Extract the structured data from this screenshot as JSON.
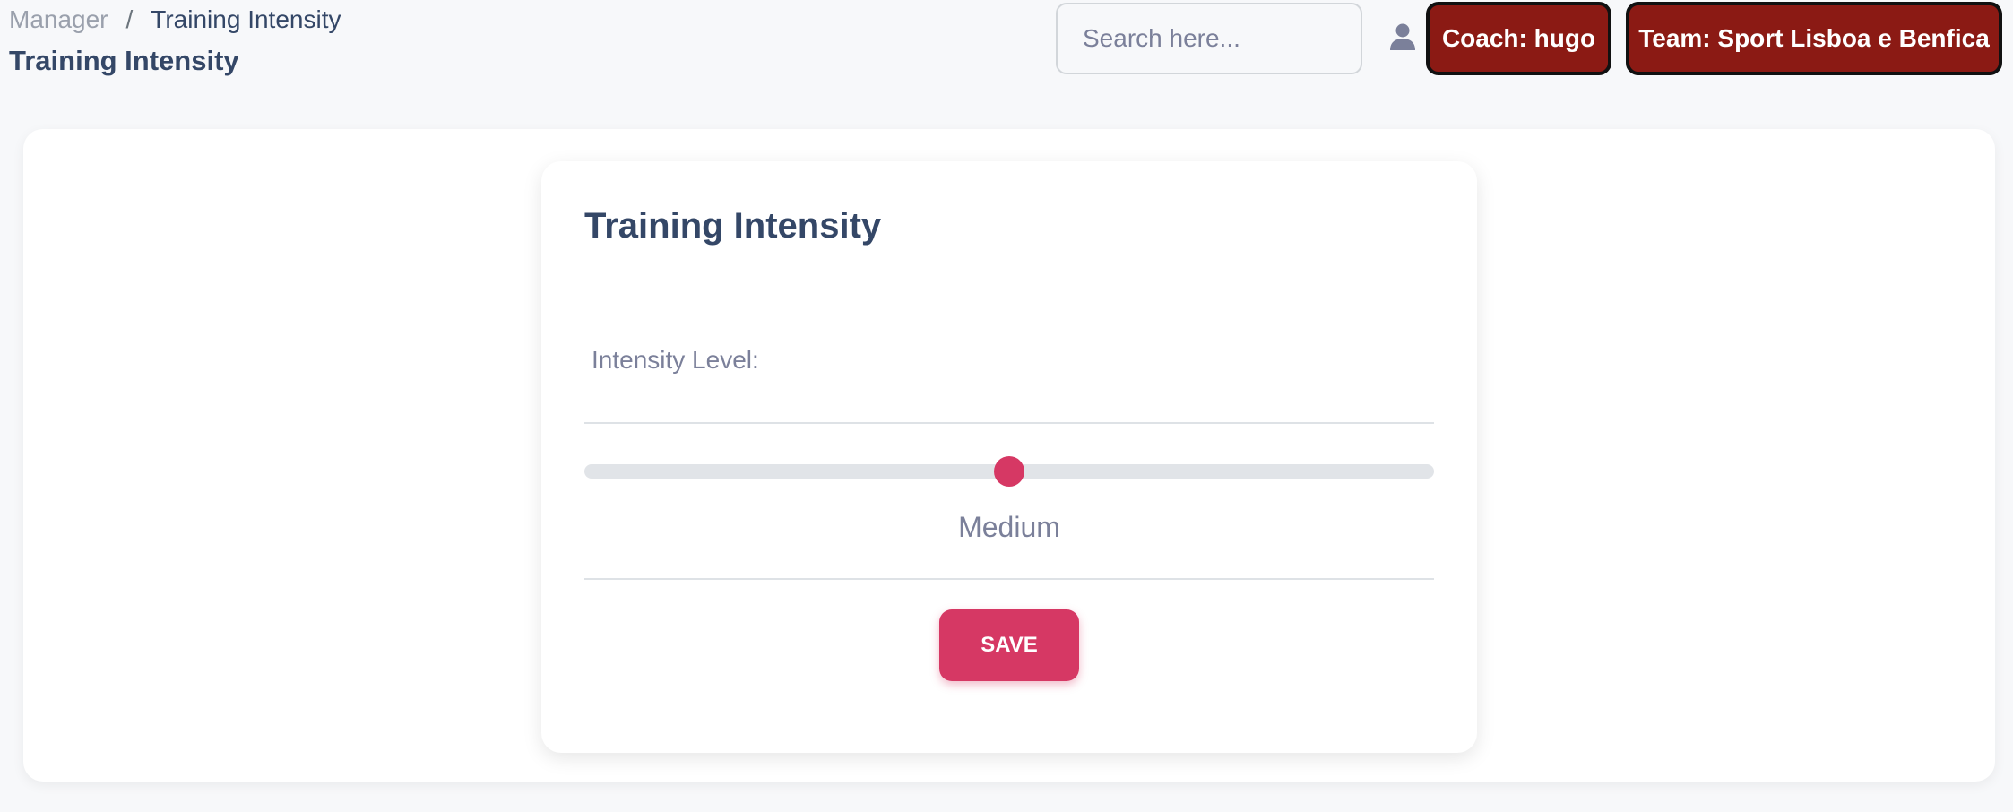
{
  "breadcrumb": {
    "parent": "Manager",
    "separator": "/",
    "current": "Training Intensity"
  },
  "header": {
    "title": "Training Intensity",
    "search_placeholder": "Search here...",
    "search_value": "",
    "user_icon": "user-icon",
    "coach_label": "Coach: hugo",
    "team_label": "Team: Sport Lisboa e Benfica"
  },
  "form": {
    "title": "Training Intensity",
    "intensity_label": "Intensity Level:",
    "intensity_value_label": "Medium",
    "intensity_fraction": 0.5,
    "save_label": "SAVE"
  },
  "colors": {
    "accent": "#d63864",
    "team_badge": "#8b1a14",
    "text_dark": "#344767",
    "text_muted": "#7b809a"
  }
}
